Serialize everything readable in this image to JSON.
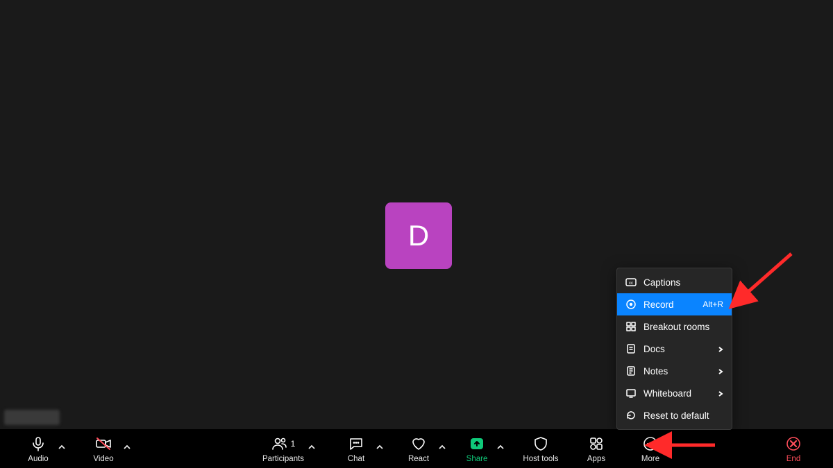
{
  "participant": {
    "initial": "D",
    "tile_color": "#b943c0"
  },
  "toolbar": {
    "audio": {
      "label": "Audio"
    },
    "video": {
      "label": "Video"
    },
    "participants": {
      "label": "Participants",
      "count": "1"
    },
    "chat": {
      "label": "Chat"
    },
    "react": {
      "label": "React"
    },
    "share": {
      "label": "Share",
      "accent": "#0fca7a"
    },
    "host_tools": {
      "label": "Host tools"
    },
    "apps": {
      "label": "Apps"
    },
    "more": {
      "label": "More"
    },
    "end": {
      "label": "End",
      "accent": "#ff4d5a"
    }
  },
  "more_menu": {
    "items": [
      {
        "label": "Captions"
      },
      {
        "label": "Record",
        "accel": "Alt+R",
        "highlighted": true
      },
      {
        "label": "Breakout rooms"
      },
      {
        "label": "Docs",
        "submenu": true
      },
      {
        "label": "Notes",
        "submenu": true
      },
      {
        "label": "Whiteboard",
        "submenu": true
      },
      {
        "label": "Reset to default"
      }
    ]
  }
}
